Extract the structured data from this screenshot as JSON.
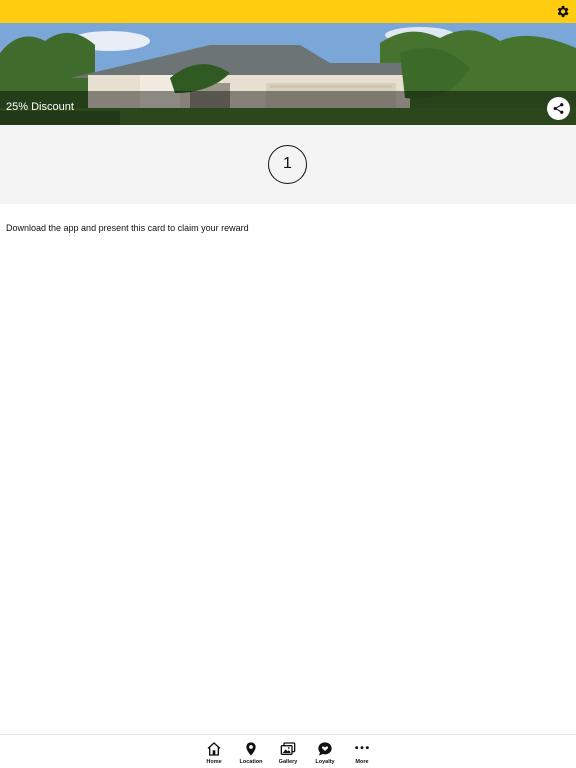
{
  "header": {
    "settings_icon": "gear-icon",
    "accent_color": "#ffcc0f"
  },
  "hero": {
    "title": "25% Discount",
    "share_icon": "share-icon"
  },
  "loyalty_card": {
    "stamps": [
      "1"
    ]
  },
  "instructions": "Download the app and present this card to claim your reward",
  "tabbar": {
    "items": [
      {
        "label": "Home",
        "icon": "home-icon"
      },
      {
        "label": "Location",
        "icon": "location-pin-icon"
      },
      {
        "label": "Gallery",
        "icon": "gallery-icon"
      },
      {
        "label": "Loyalty",
        "icon": "loyalty-icon"
      },
      {
        "label": "More",
        "icon": "more-icon"
      }
    ]
  }
}
